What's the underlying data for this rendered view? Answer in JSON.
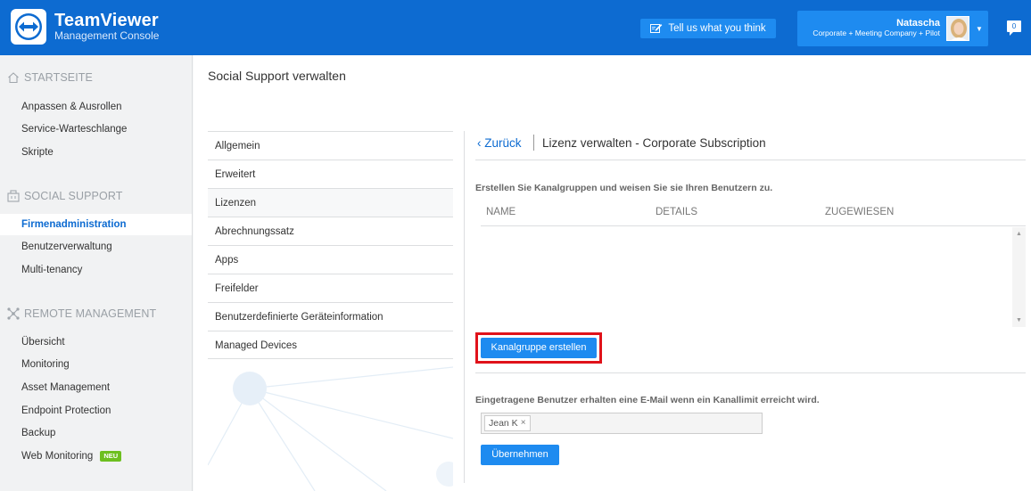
{
  "header": {
    "brand_name": "TeamViewer",
    "brand_sub": "Management Console",
    "feedback_label": "Tell us what you think",
    "user_name": "Natascha",
    "user_org": "Corporate + Meeting Company + Pilot",
    "notification_count": "0",
    "icons": {
      "logo": "teamviewer-logo-icon",
      "feedback": "edit-icon",
      "caret": "caret-down-icon",
      "notification": "chat-bubble-icon"
    }
  },
  "sidebar": {
    "sections": [
      {
        "title": "STARTSEITE",
        "icon": "home-icon",
        "items": [
          "Anpassen & Ausrollen",
          "Service-Warteschlange",
          "Skripte"
        ]
      },
      {
        "title": "SOCIAL SUPPORT",
        "icon": "social-support-icon",
        "items": [
          "Firmenadministration",
          "Benutzerverwaltung",
          "Multi-tenancy"
        ]
      },
      {
        "title": "REMOTE MANAGEMENT",
        "icon": "remote-management-icon",
        "items": [
          "Übersicht",
          "Monitoring",
          "Asset Management",
          "Endpoint Protection",
          "Backup",
          "Web Monitoring"
        ]
      }
    ],
    "active_item": "Firmenadministration",
    "badge_new": "NEU"
  },
  "main": {
    "page_title": "Social Support verwalten",
    "submenu": [
      "Allgemein",
      "Erweitert",
      "Lizenzen",
      "Abrechnungssatz",
      "Apps",
      "Freifelder",
      "Benutzerdefinierte Geräteinformation",
      "Managed Devices"
    ],
    "active_submenu": "Lizenzen",
    "back_label": "Zurück",
    "license_title": "Lizenz verwalten - Corporate Subscription",
    "channel_desc": "Erstellen Sie Kanalgruppen und weisen Sie sie Ihren Benutzern zu.",
    "columns": [
      "NAME",
      "DETAILS",
      "ZUGEWIESEN"
    ],
    "create_label": "Kanalgruppe erstellen",
    "email_desc": "Eingetragene Benutzer erhalten eine E-Mail wenn ein Kanallimit erreicht wird.",
    "tag_value": "Jean K",
    "tag_remove": "×",
    "apply_label": "Übernehmen"
  },
  "colors": {
    "brand": "#0d6bd1",
    "button": "#1e8bf0",
    "highlight": "#e0121a",
    "badge": "#6dbf20"
  }
}
